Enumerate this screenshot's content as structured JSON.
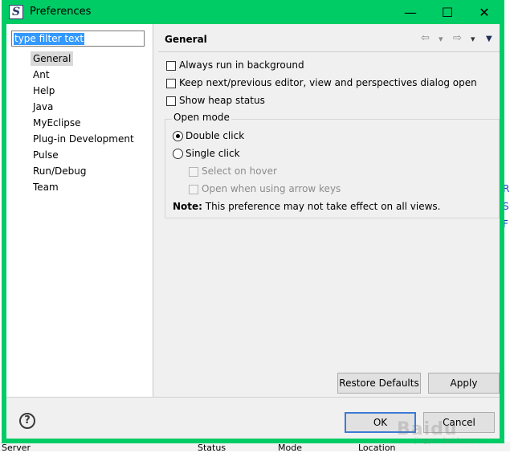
{
  "window": {
    "title": "Preferences",
    "min_symbol": "—",
    "max_symbol": "☐",
    "close_symbol": "✕",
    "app_icon_glyph": "S"
  },
  "filter": {
    "value": "type filter text"
  },
  "tree": {
    "items": [
      {
        "label": "General",
        "selected": true
      },
      {
        "label": "Ant"
      },
      {
        "label": "Help"
      },
      {
        "label": "Java"
      },
      {
        "label": "MyEclipse"
      },
      {
        "label": "Plug-in Development"
      },
      {
        "label": "Pulse"
      },
      {
        "label": "Run/Debug"
      },
      {
        "label": "Team"
      }
    ]
  },
  "page": {
    "title": "General",
    "nav": {
      "back": "⇦",
      "back_menu": "▾",
      "forward": "⇨",
      "forward_menu": "▾",
      "view_menu": "▼"
    },
    "options": [
      {
        "label": "Always run in background",
        "checked": false
      },
      {
        "label": "Keep next/previous editor, view and perspectives dialog open",
        "checked": false
      },
      {
        "label": "Show heap status",
        "checked": false
      }
    ],
    "open_mode": {
      "title": "Open mode",
      "double_click": "Double click",
      "single_click": "Single click",
      "select_on_hover": "Select on hover",
      "open_arrow_keys": "Open when using arrow keys",
      "note_label": "Note:",
      "note_text": " This preference may not take effect on all views.",
      "selected": "double_click"
    },
    "restore_defaults": "Restore Defaults",
    "apply": "Apply"
  },
  "footer": {
    "help_glyph": "?",
    "ok": "OK",
    "cancel": "Cancel"
  },
  "background": {
    "col1": "Server",
    "col2": "Status",
    "col3": "Mode",
    "col4": "Location",
    "right_marks": [
      "R",
      "S",
      "F"
    ]
  },
  "watermark": {
    "main": "Baidu",
    "sub": "jingyan.baidu.com"
  },
  "colors": {
    "title_bar": "#00cc66",
    "selection": "#3399ff",
    "default_button_border": "#3d7ad6"
  }
}
